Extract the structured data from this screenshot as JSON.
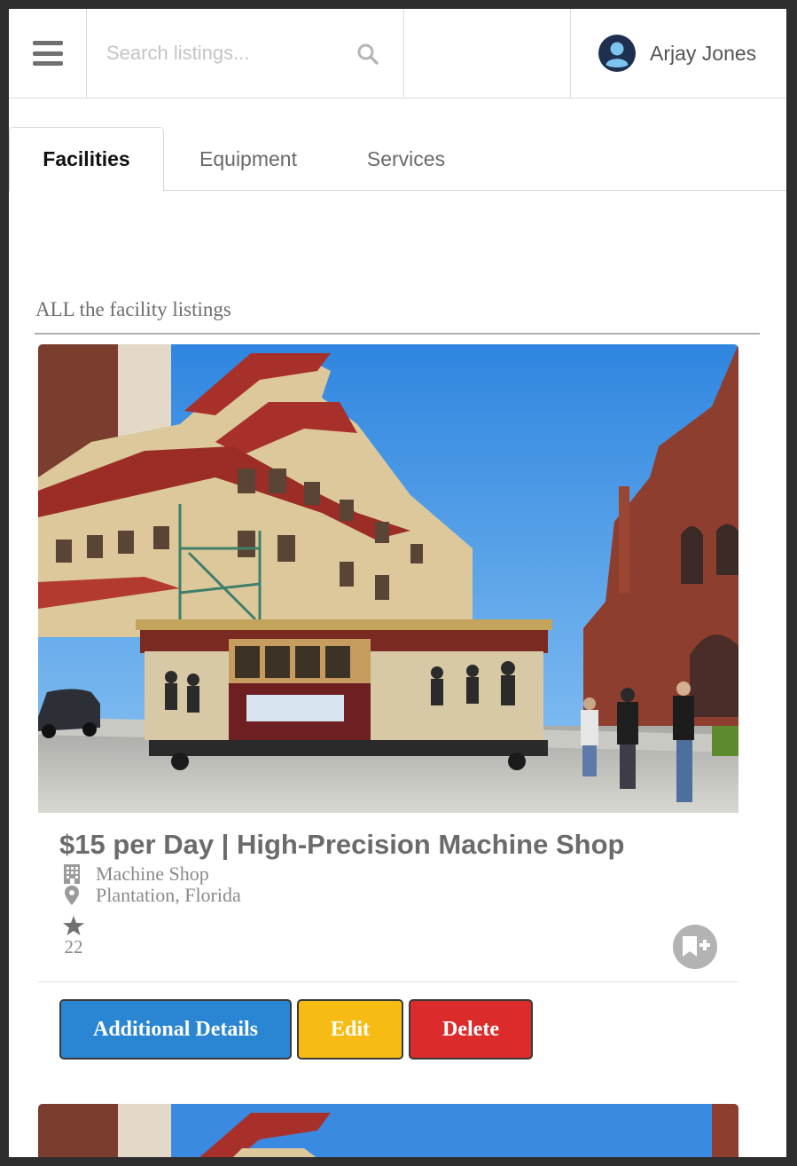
{
  "header": {
    "search": {
      "placeholder": "Search listings...",
      "value": ""
    },
    "user": {
      "name": "Arjay Jones"
    },
    "icons": {
      "menu": "hamburger-menu-icon",
      "search": "search-icon",
      "avatar": "user-avatar-icon"
    }
  },
  "tabs": [
    {
      "label": "Facilities",
      "active": true
    },
    {
      "label": "Equipment",
      "active": false
    },
    {
      "label": "Services",
      "active": false
    }
  ],
  "section": {
    "title": "ALL the facility listings"
  },
  "listings": [
    {
      "title": "$15 per Day | High-Precision Machine Shop",
      "category": "Machine Shop",
      "location": "Plantation, Florida",
      "rating_count": "22",
      "icons": {
        "category": "building-icon",
        "location": "map-pin-icon",
        "rating": "star-icon",
        "bookmark": "bookmark-add-icon"
      },
      "buttons": {
        "details": "Additional Details",
        "edit": "Edit",
        "delete": "Delete"
      }
    }
  ],
  "colors": {
    "details_button": "#2a86d2",
    "edit_button": "#f6bc14",
    "delete_button": "#db2b2b",
    "avatar_circle": "#1e2f4f",
    "avatar_figure": "#7dc4ee",
    "bookmark_button": "#b3b3b3"
  }
}
